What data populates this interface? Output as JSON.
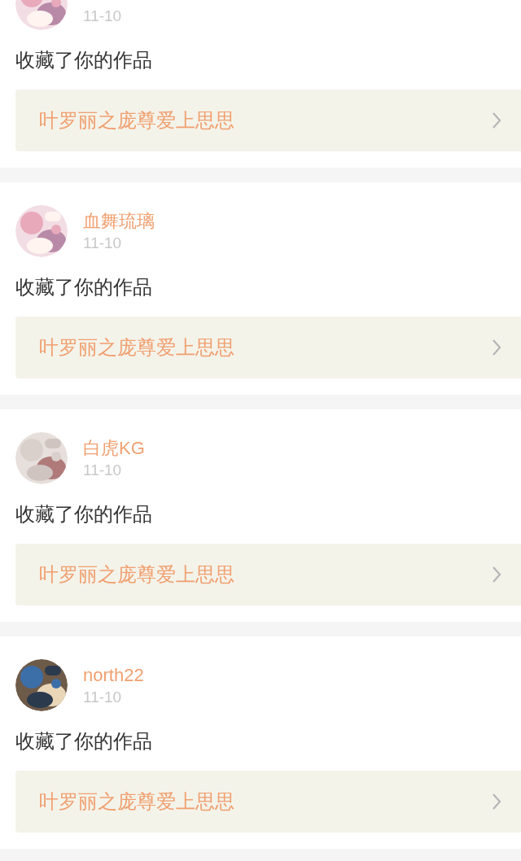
{
  "notifications": [
    {
      "date": "11-10",
      "action": "收藏了你的作品",
      "work": "叶罗丽之庞尊爱上思思"
    },
    {
      "user": "血舞琉璃",
      "date": "11-10",
      "action": "收藏了你的作品",
      "work": "叶罗丽之庞尊爱上思思"
    },
    {
      "user": "白虎KG",
      "date": "11-10",
      "action": "收藏了你的作品",
      "work": "叶罗丽之庞尊爱上思思"
    },
    {
      "user": "north22",
      "date": "11-10",
      "action": "收藏了你的作品",
      "work": "叶罗丽之庞尊爱上思思"
    }
  ]
}
